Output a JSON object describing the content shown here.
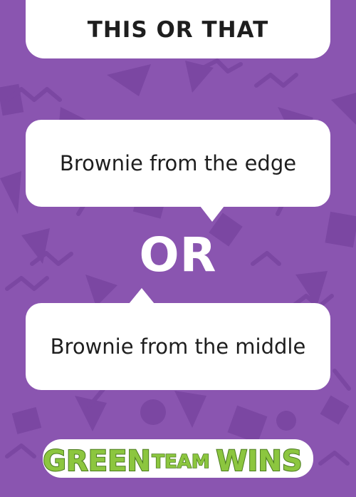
{
  "card": {
    "title": "THIS OR THAT",
    "option_a": "Brownie from the edge",
    "connector": "OR",
    "option_b": "Brownie from the middle"
  },
  "logo": {
    "text": "GREEN TEAM WINS",
    "word_1": "GREEN",
    "word_2": "TEAM",
    "word_3": "WINS"
  },
  "colors": {
    "background": "#8a55b0",
    "pattern": "#7d49a4",
    "card": "#ffffff",
    "logo_green": "#8cc63f",
    "logo_outline": "#4a7a1f"
  }
}
